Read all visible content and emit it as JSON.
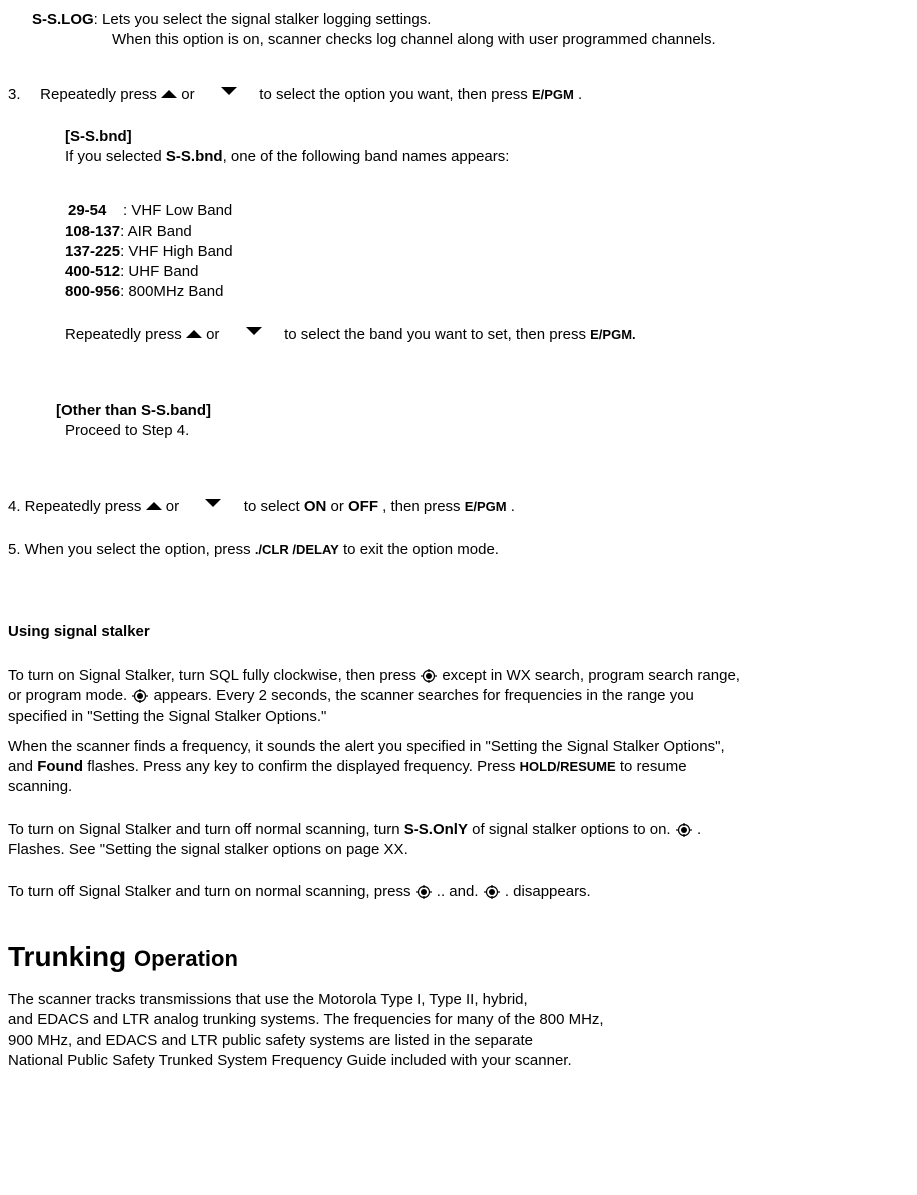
{
  "sslog": {
    "label": "S-S.LOG",
    "desc": ": Lets you select the signal stalker logging settings.",
    "desc2": "When this option is on, scanner checks log channel along with user programmed channels."
  },
  "step3": {
    "num": "3.",
    "pre": "Repeatedly press ",
    "mid": "or",
    "post": " to select the option you want, then press ",
    "key": "E/PGM",
    "end": "."
  },
  "ssbnd": {
    "header": "[S-S.bnd]",
    "line": "If you selected ",
    "bold": "S-S.bnd",
    "line2": ", one of the following band names appears:"
  },
  "bands": [
    {
      "range": "29-54",
      "pad": "    ",
      "name": ": VHF Low Band"
    },
    {
      "range": "108-137",
      "pad": "",
      "name": ": AIR Band"
    },
    {
      "range": "137-225",
      "pad": "",
      "name": ": VHF High Band"
    },
    {
      "range": "400-512",
      "pad": "",
      "name": ": UHF Band"
    },
    {
      "range": "800-956",
      "pad": "",
      "name": ": 800MHz Band"
    }
  ],
  "bandpress": {
    "pre": "Repeatedly press ",
    "mid": "or",
    "post": " to select the band you want to set, then press ",
    "key": "E/PGM.",
    "end": ""
  },
  "other": {
    "header": "[Other than S-S.band]",
    "line": "Proceed to Step 4."
  },
  "step4": {
    "pre": "4. Repeatedly press ",
    "mid": "or",
    "post": " to select ",
    "on": "ON",
    "or": " or ",
    "off": "OFF",
    "then": ", then press ",
    "key": "E/PGM",
    "end": "."
  },
  "step5": {
    "pre": "5. When you select the option, press  ",
    "key": "./CLR /DELAY",
    "post": " to exit the option mode."
  },
  "using": {
    "header": "Using signal stalker",
    "p1a": "To turn on Signal Stalker, turn SQL fully clockwise, then press ",
    "p1b": "except in WX search, program search range,",
    "p1c": "or program mode. ",
    "p1d": " appears. Every 2 seconds, the scanner searches for frequencies in the range you",
    "p1e": "specified in \"Setting the Signal Stalker Options.\"",
    "p2a": "When the scanner finds a frequency, it sounds the alert you specified in    \"Setting the Signal Stalker Options\",",
    "p2b": "and ",
    "p2bold": "Found",
    "p2c": " flashes. Press any key to confirm the displayed frequency. Press ",
    "p2key": "HOLD/RESUME",
    "p2d": " to resume",
    "p2e": "scanning.",
    "p3a": "To turn on Signal Stalker and turn off normal scanning, turn ",
    "p3bold": "S-S.OnlY",
    "p3b": " of signal stalker options to on. ",
    "p3c": ".",
    "p3d": "Flashes.    See \"Setting the signal stalker options on page XX.",
    "p4a": "To turn off Signal Stalker and turn on normal scanning, press",
    "p4b": ".. and. ",
    "p4c": ". disappears."
  },
  "trunking": {
    "h1": "Trunking ",
    "h2": "Operation",
    "l1": "The scanner tracks transmissions that use the Motorola Type I, Type II, hybrid,",
    "l2": "and EDACS and LTR analog trunking systems. The frequencies for many of the 800 MHz,",
    "l3": "900 MHz, and EDACS and LTR public safety systems are listed in the separate",
    "l4": "National Public Safety Trunked System Frequency Guide included with your scanner."
  }
}
